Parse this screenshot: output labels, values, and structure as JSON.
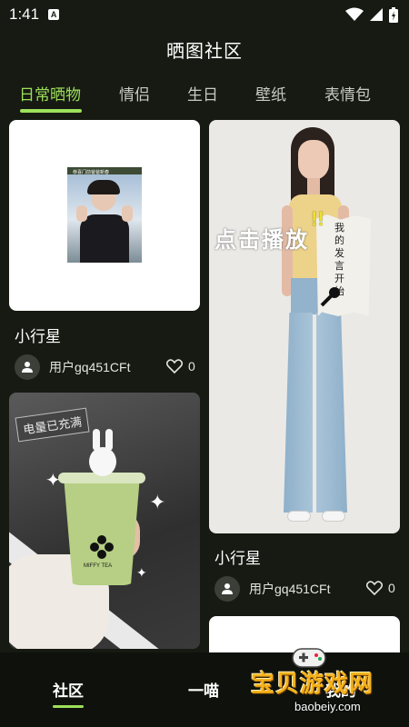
{
  "status": {
    "time": "1:41",
    "notif_glyph": "A"
  },
  "header": {
    "title": "晒图社区"
  },
  "tabs": [
    {
      "label": "日常晒物",
      "active": true
    },
    {
      "label": "情侣",
      "active": false
    },
    {
      "label": "生日",
      "active": false
    },
    {
      "label": "壁纸",
      "active": false
    },
    {
      "label": "表情包",
      "active": false
    }
  ],
  "feed": {
    "card1": {
      "caption": "小行星",
      "user": "用户gq451CFt",
      "likes": "0",
      "photo_caption": "恭喜门前爸爸新春"
    },
    "card2": {
      "caption": "小行星",
      "user": "用户gq451CFt",
      "likes": "0",
      "overlay_text": "点击播放",
      "sticker_text": "我的发言开始"
    },
    "card3": {
      "sticker_text": "电量已充满",
      "cup_brand": "MIFFY TEA"
    }
  },
  "bottom_nav": [
    {
      "label": "社区",
      "active": true
    },
    {
      "label": "一喵",
      "active": false
    },
    {
      "label": "我的",
      "active": false
    }
  ],
  "watermark": {
    "main": "宝贝游戏网",
    "sub": "baobeiy.com"
  },
  "colors": {
    "accent": "#9de05a",
    "background": "#161a12"
  }
}
